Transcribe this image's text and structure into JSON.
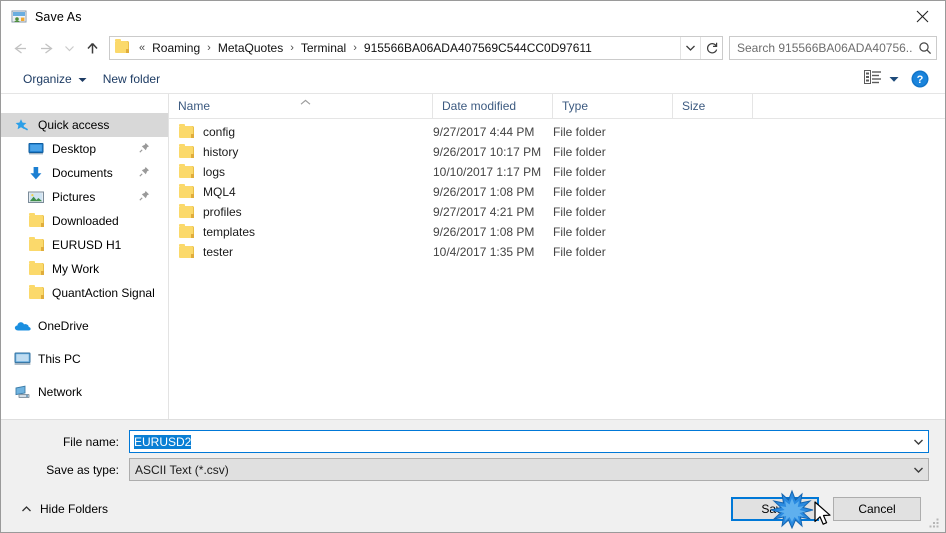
{
  "window": {
    "title": "Save As",
    "title_icon": "save-as-icon",
    "close_icon": "close-icon"
  },
  "navigation": {
    "back_icon": "back-arrow-icon",
    "forward_icon": "forward-arrow-icon",
    "recent_icon": "chevron-down-icon",
    "up_icon": "up-arrow-icon",
    "folder_icon": "folder-icon",
    "overflow": "«",
    "breadcrumbs": [
      "Roaming",
      "MetaQuotes",
      "Terminal",
      "915566BA06ADA407569C544CC0D97611"
    ],
    "separator": "›",
    "dropdown_icon": "chevron-down-icon",
    "refresh_icon": "refresh-icon"
  },
  "search": {
    "placeholder": "Search 915566BA06ADA40756...",
    "value": "",
    "icon": "search-icon"
  },
  "commandbar": {
    "organize_label": "Organize",
    "organize_icon": "caret-down-icon",
    "new_folder_label": "New folder",
    "view_icon": "view-layout-icon",
    "view_dropdown_icon": "caret-down-icon",
    "help_icon": "help-icon",
    "help_label": "?"
  },
  "sidebar": {
    "items": [
      {
        "label": "Quick access",
        "icon": "star-pin-icon",
        "selected": true,
        "level": "group",
        "pinned": false
      },
      {
        "label": "Desktop",
        "icon": "desktop-icon",
        "selected": false,
        "level": "child",
        "pinned": true
      },
      {
        "label": "Documents",
        "icon": "documents-icon",
        "selected": false,
        "level": "child",
        "pinned": true
      },
      {
        "label": "Pictures",
        "icon": "pictures-icon",
        "selected": false,
        "level": "child",
        "pinned": true
      },
      {
        "label": "Downloaded",
        "icon": "folder-icon",
        "selected": false,
        "level": "child",
        "pinned": false
      },
      {
        "label": "EURUSD H1",
        "icon": "folder-icon",
        "selected": false,
        "level": "child",
        "pinned": false
      },
      {
        "label": "My Work",
        "icon": "folder-icon",
        "selected": false,
        "level": "child",
        "pinned": false
      },
      {
        "label": "QuantAction Signal",
        "icon": "folder-icon",
        "selected": false,
        "level": "child",
        "pinned": false
      },
      {
        "label": "OneDrive",
        "icon": "onedrive-icon",
        "selected": false,
        "level": "group",
        "pinned": false
      },
      {
        "label": "This PC",
        "icon": "this-pc-icon",
        "selected": false,
        "level": "group",
        "pinned": false
      },
      {
        "label": "Network",
        "icon": "network-icon",
        "selected": false,
        "level": "group",
        "pinned": false
      }
    ]
  },
  "filelist": {
    "columns": [
      {
        "label": "Name",
        "sorted": "ascending"
      },
      {
        "label": "Date modified",
        "sorted": ""
      },
      {
        "label": "Type",
        "sorted": ""
      },
      {
        "label": "Size",
        "sorted": ""
      }
    ],
    "sort_caret_icon": "caret-up-icon",
    "rows": [
      {
        "name": "config",
        "date": "9/27/2017 4:44 PM",
        "type": "File folder",
        "size": "",
        "icon": "folder-icon"
      },
      {
        "name": "history",
        "date": "9/26/2017 10:17 PM",
        "type": "File folder",
        "size": "",
        "icon": "folder-icon"
      },
      {
        "name": "logs",
        "date": "10/10/2017 1:17 PM",
        "type": "File folder",
        "size": "",
        "icon": "folder-icon"
      },
      {
        "name": "MQL4",
        "date": "9/26/2017 1:08 PM",
        "type": "File folder",
        "size": "",
        "icon": "folder-icon"
      },
      {
        "name": "profiles",
        "date": "9/27/2017 4:21 PM",
        "type": "File folder",
        "size": "",
        "icon": "folder-icon"
      },
      {
        "name": "templates",
        "date": "9/26/2017 1:08 PM",
        "type": "File folder",
        "size": "",
        "icon": "folder-icon"
      },
      {
        "name": "tester",
        "date": "10/4/2017 1:35 PM",
        "type": "File folder",
        "size": "",
        "icon": "folder-icon"
      }
    ]
  },
  "form": {
    "filename_label": "File name:",
    "filename_value": "EURUSD2",
    "filename_selected": true,
    "filetype_label": "Save as type:",
    "filetype_value": "ASCII Text (*.csv)",
    "dropdown_icon": "chevron-down-icon"
  },
  "footer": {
    "hide_folders_label": "Hide Folders",
    "hide_folders_icon": "chevron-up-icon",
    "save_label": "Save",
    "cancel_label": "Cancel",
    "resize_grip_icon": "resize-grip-icon",
    "cursor_icon": "mouse-pointer-icon",
    "click_effect_icon": "click-burst-icon"
  },
  "colors": {
    "accent": "#0078d7",
    "selection": "#0a7fd4",
    "folder_yellow": "#fbd96b",
    "breadcrumb_text": "#111111",
    "command_link": "#1e3c64",
    "column_header": "#3c5a80",
    "panel_background": "#f0f0f0",
    "sidebar_selected": "#d8d8d8"
  }
}
